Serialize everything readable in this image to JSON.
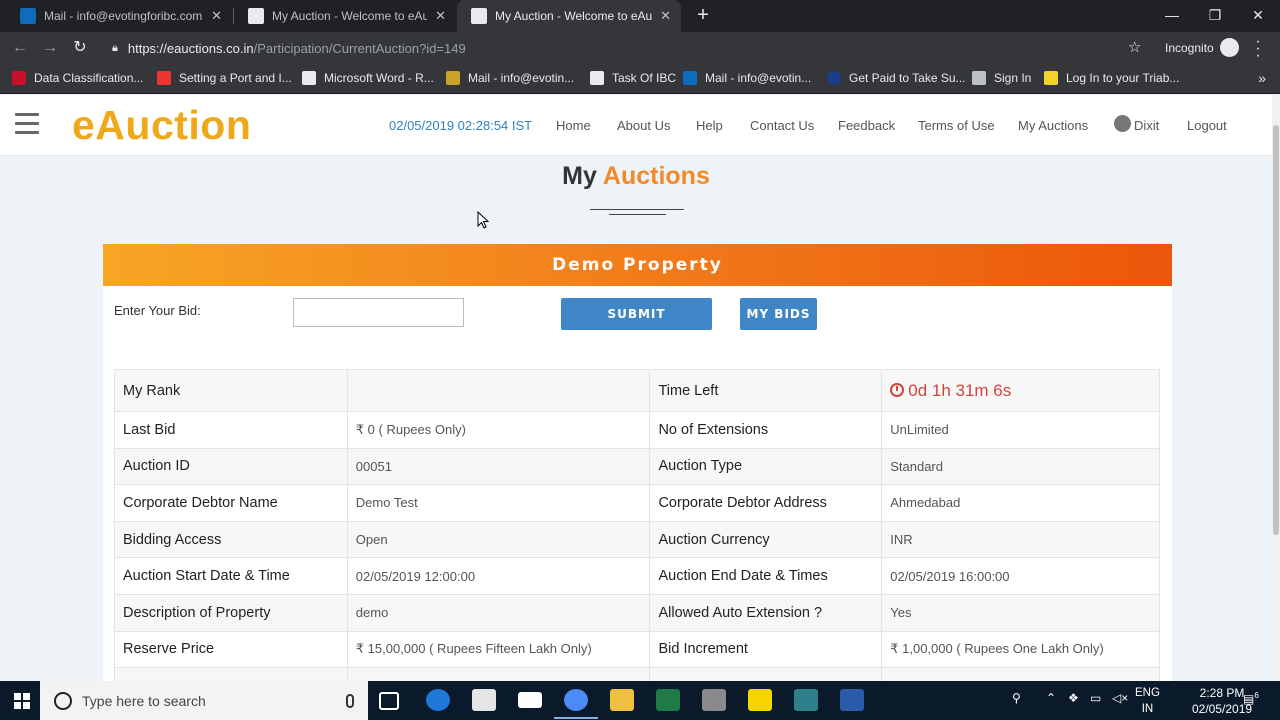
{
  "browser": {
    "tabs": [
      {
        "title": "Mail - info@evotingforibc.com",
        "active": false
      },
      {
        "title": "My Auction - Welcome to eAuctio",
        "active": false
      },
      {
        "title": "My Auction - Welcome to eAuctio",
        "active": true
      }
    ],
    "new_tab": "+",
    "url_host": "https://eauctions.co.in",
    "url_path": "/Participation/CurrentAuction?id=149",
    "incognito_label": "Incognito",
    "bookmarks": [
      "Data Classification...",
      "Setting a Port and I...",
      "Microsoft Word - R...",
      "Mail - info@evotin...",
      "Task Of IBC",
      "Mail - info@evotin...",
      "Get Paid to Take Su...",
      "Sign In",
      "Log In to your Triab..."
    ],
    "bookmarks_more": "»"
  },
  "site": {
    "logo": "eAuction",
    "datetime": "02/05/2019 02:28:54 IST",
    "menu": {
      "home": "Home",
      "about": "About Us",
      "help": "Help",
      "contact": "Contact Us",
      "feedback": "Feedback",
      "terms": "Terms of Use",
      "my_auctions": "My Auctions",
      "user": "Dixit",
      "logout": "Logout"
    },
    "page_title_part1": "My",
    "page_title_part2": "Auctions"
  },
  "auction": {
    "name": "Demo Property",
    "bid_label": "Enter Your Bid:",
    "bid_value": "",
    "submit_label": "SUBMIT",
    "my_bids_label": "MY BIDS",
    "rows": [
      {
        "k1": "My Rank",
        "v1": "",
        "k2": "Time Left",
        "v2": "0d 1h 31m 6s"
      },
      {
        "k1": "Last Bid",
        "v1": "₹ 0   ( Rupees Only)",
        "k2": "No of Extensions",
        "v2": "UnLimited"
      },
      {
        "k1": "Auction ID",
        "v1": "00051",
        "k2": "Auction Type",
        "v2": "Standard"
      },
      {
        "k1": "Corporate Debtor Name",
        "v1": "Demo Test",
        "k2": "Corporate Debtor Address",
        "v2": "Ahmedabad"
      },
      {
        "k1": "Bidding Access",
        "v1": "Open",
        "k2": "Auction Currency",
        "v2": "INR"
      },
      {
        "k1": "Auction Start Date & Time",
        "v1": "02/05/2019 12:00:00",
        "k2": "Auction End Date & Times",
        "v2": "02/05/2019 16:00:00"
      },
      {
        "k1": "Description of Property",
        "v1": "demo",
        "k2": "Allowed Auto Extension ?",
        "v2": "Yes"
      },
      {
        "k1": "Reserve Price",
        "v1": "₹ 15,00,000   ( Rupees Fifteen Lakh Only)",
        "k2": "Bid Increment",
        "v2": "₹ 1,00,000   ( Rupees One Lakh Only)"
      },
      {
        "k1": "",
        "v1": "",
        "k2": "",
        "v2": ""
      }
    ]
  },
  "taskbar": {
    "search_placeholder": "Type here to search",
    "lang_line1": "ENG",
    "lang_line2": "IN",
    "time": "2:28 PM",
    "date": "02/05/2019",
    "notifications": "6"
  },
  "colors": {
    "accent_blue": "#3f86c7",
    "orange": "#f08a2a",
    "time_left_red": "#d2443a"
  }
}
